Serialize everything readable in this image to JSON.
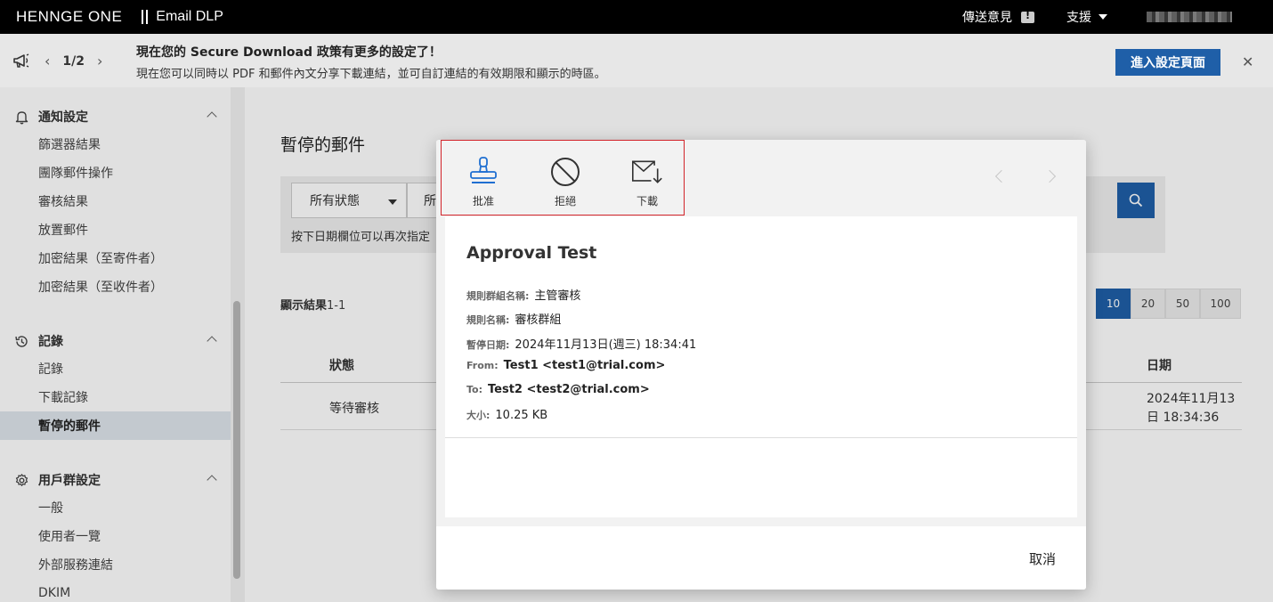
{
  "topbar": {
    "brand": "HENNGE One",
    "product": "Email DLP",
    "feedback_label": "傳送意見",
    "support_label": "支援"
  },
  "banner": {
    "page": "1/2",
    "title": "現在您的 Secure Download 政策有更多的設定了！",
    "text": "現在您可以同時以 PDF 和郵件內文分享下載連結，並可自訂連結的有效期限和顯示的時區。",
    "button_label": "進入設定頁面"
  },
  "sidebar": {
    "sections": [
      {
        "title": "通知設定",
        "items": [
          "篩選器結果",
          "團隊郵件操作",
          "審核結果",
          "放置郵件",
          "加密結果（至寄件者）",
          "加密結果（至收件者）"
        ]
      },
      {
        "title": "記錄",
        "items": [
          "記錄",
          "下載記錄",
          "暫停的郵件"
        ]
      },
      {
        "title": "用戶群設定",
        "items": [
          "一般",
          "使用者一覽",
          "外部服務連結",
          "DKIM"
        ]
      }
    ]
  },
  "main": {
    "title": "暫停的郵件",
    "status_filter": "所有狀態",
    "second_filter": "所",
    "hint": "按下日期欄位可以再次指定",
    "results_label": "顯示結果",
    "results_range": "1-1",
    "page_sizes": [
      "10",
      "20",
      "50",
      "100"
    ],
    "columns": {
      "status": "狀態",
      "date": "日期"
    },
    "rows": [
      {
        "status": "等待審核",
        "date": "2024年11月13日 18:34:36"
      }
    ]
  },
  "modal": {
    "actions": {
      "approve": "批准",
      "reject": "拒絕",
      "download": "下載"
    },
    "subject": "Approval Test",
    "fields": {
      "rule_group_key": "規則群組名稱:",
      "rule_group_val": "主管審核",
      "rule_name_key": "規則名稱:",
      "rule_name_val": "審核群組",
      "paused_date_key": "暫停日期:",
      "paused_date_val": "2024年11月13日(週三) 18:34:41",
      "from_key": "From:",
      "from_val": "Test1 <test1@trial.com>",
      "to_key": "To:",
      "to_val": "Test2 <test2@trial.com>",
      "size_key": "大小:",
      "size_val": "10.25 KB"
    },
    "cancel_label": "取消"
  },
  "colors": {
    "accent": "#1f5fa8",
    "highlight": "#d2242a",
    "topbar": "#000000",
    "sidebar_active": "#dfe5ec"
  }
}
